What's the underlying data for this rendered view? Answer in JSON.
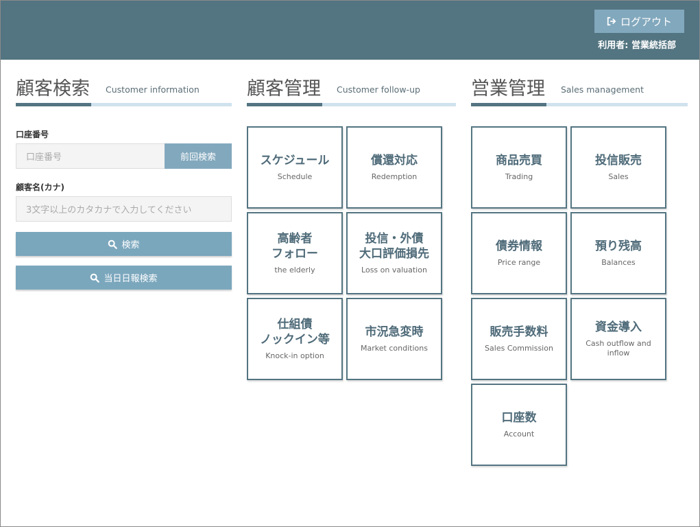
{
  "header": {
    "logout_label": "ログアウト",
    "user_label": "利用者: 営業統括部"
  },
  "sections": {
    "customer_search": {
      "title": "顧客検索",
      "subtitle": "Customer information"
    },
    "customer_management": {
      "title": "顧客管理",
      "subtitle": "Customer follow-up"
    },
    "sales_management": {
      "title": "営業管理",
      "subtitle": "Sales management"
    }
  },
  "search_form": {
    "account_label": "口座番号",
    "account_placeholder": "口座番号",
    "prev_search_label": "前回検索",
    "kana_label": "顧客名(カナ)",
    "kana_placeholder": "3文字以上のカタカナで入力してください",
    "search_label": "検索",
    "daily_report_label": "当日日報検索"
  },
  "customer_tiles": [
    {
      "jp": "スケジュール",
      "en": "Schedule"
    },
    {
      "jp": "償還対応",
      "en": "Redemption"
    },
    {
      "jp": "高齢者\nフォロー",
      "en": "the elderly"
    },
    {
      "jp": "投信・外債\n大口評価損先",
      "en": "Loss on valuation"
    },
    {
      "jp": "仕組債\nノックイン等",
      "en": "Knock-in option"
    },
    {
      "jp": "市況急変時",
      "en": "Market conditions"
    }
  ],
  "sales_tiles": [
    {
      "jp": "商品売買",
      "en": "Trading"
    },
    {
      "jp": "投信販売",
      "en": "Sales"
    },
    {
      "jp": "債券情報",
      "en": "Price range"
    },
    {
      "jp": "預り残高",
      "en": "Balances"
    },
    {
      "jp": "販売手数料",
      "en": "Sales Commission"
    },
    {
      "jp": "資金導入",
      "en": "Cash outflow and inflow"
    },
    {
      "jp": "口座数",
      "en": "Account"
    }
  ],
  "colors": {
    "header": "#537481",
    "button": "#82a8bd",
    "accent_bar": "#cfe2ee"
  }
}
